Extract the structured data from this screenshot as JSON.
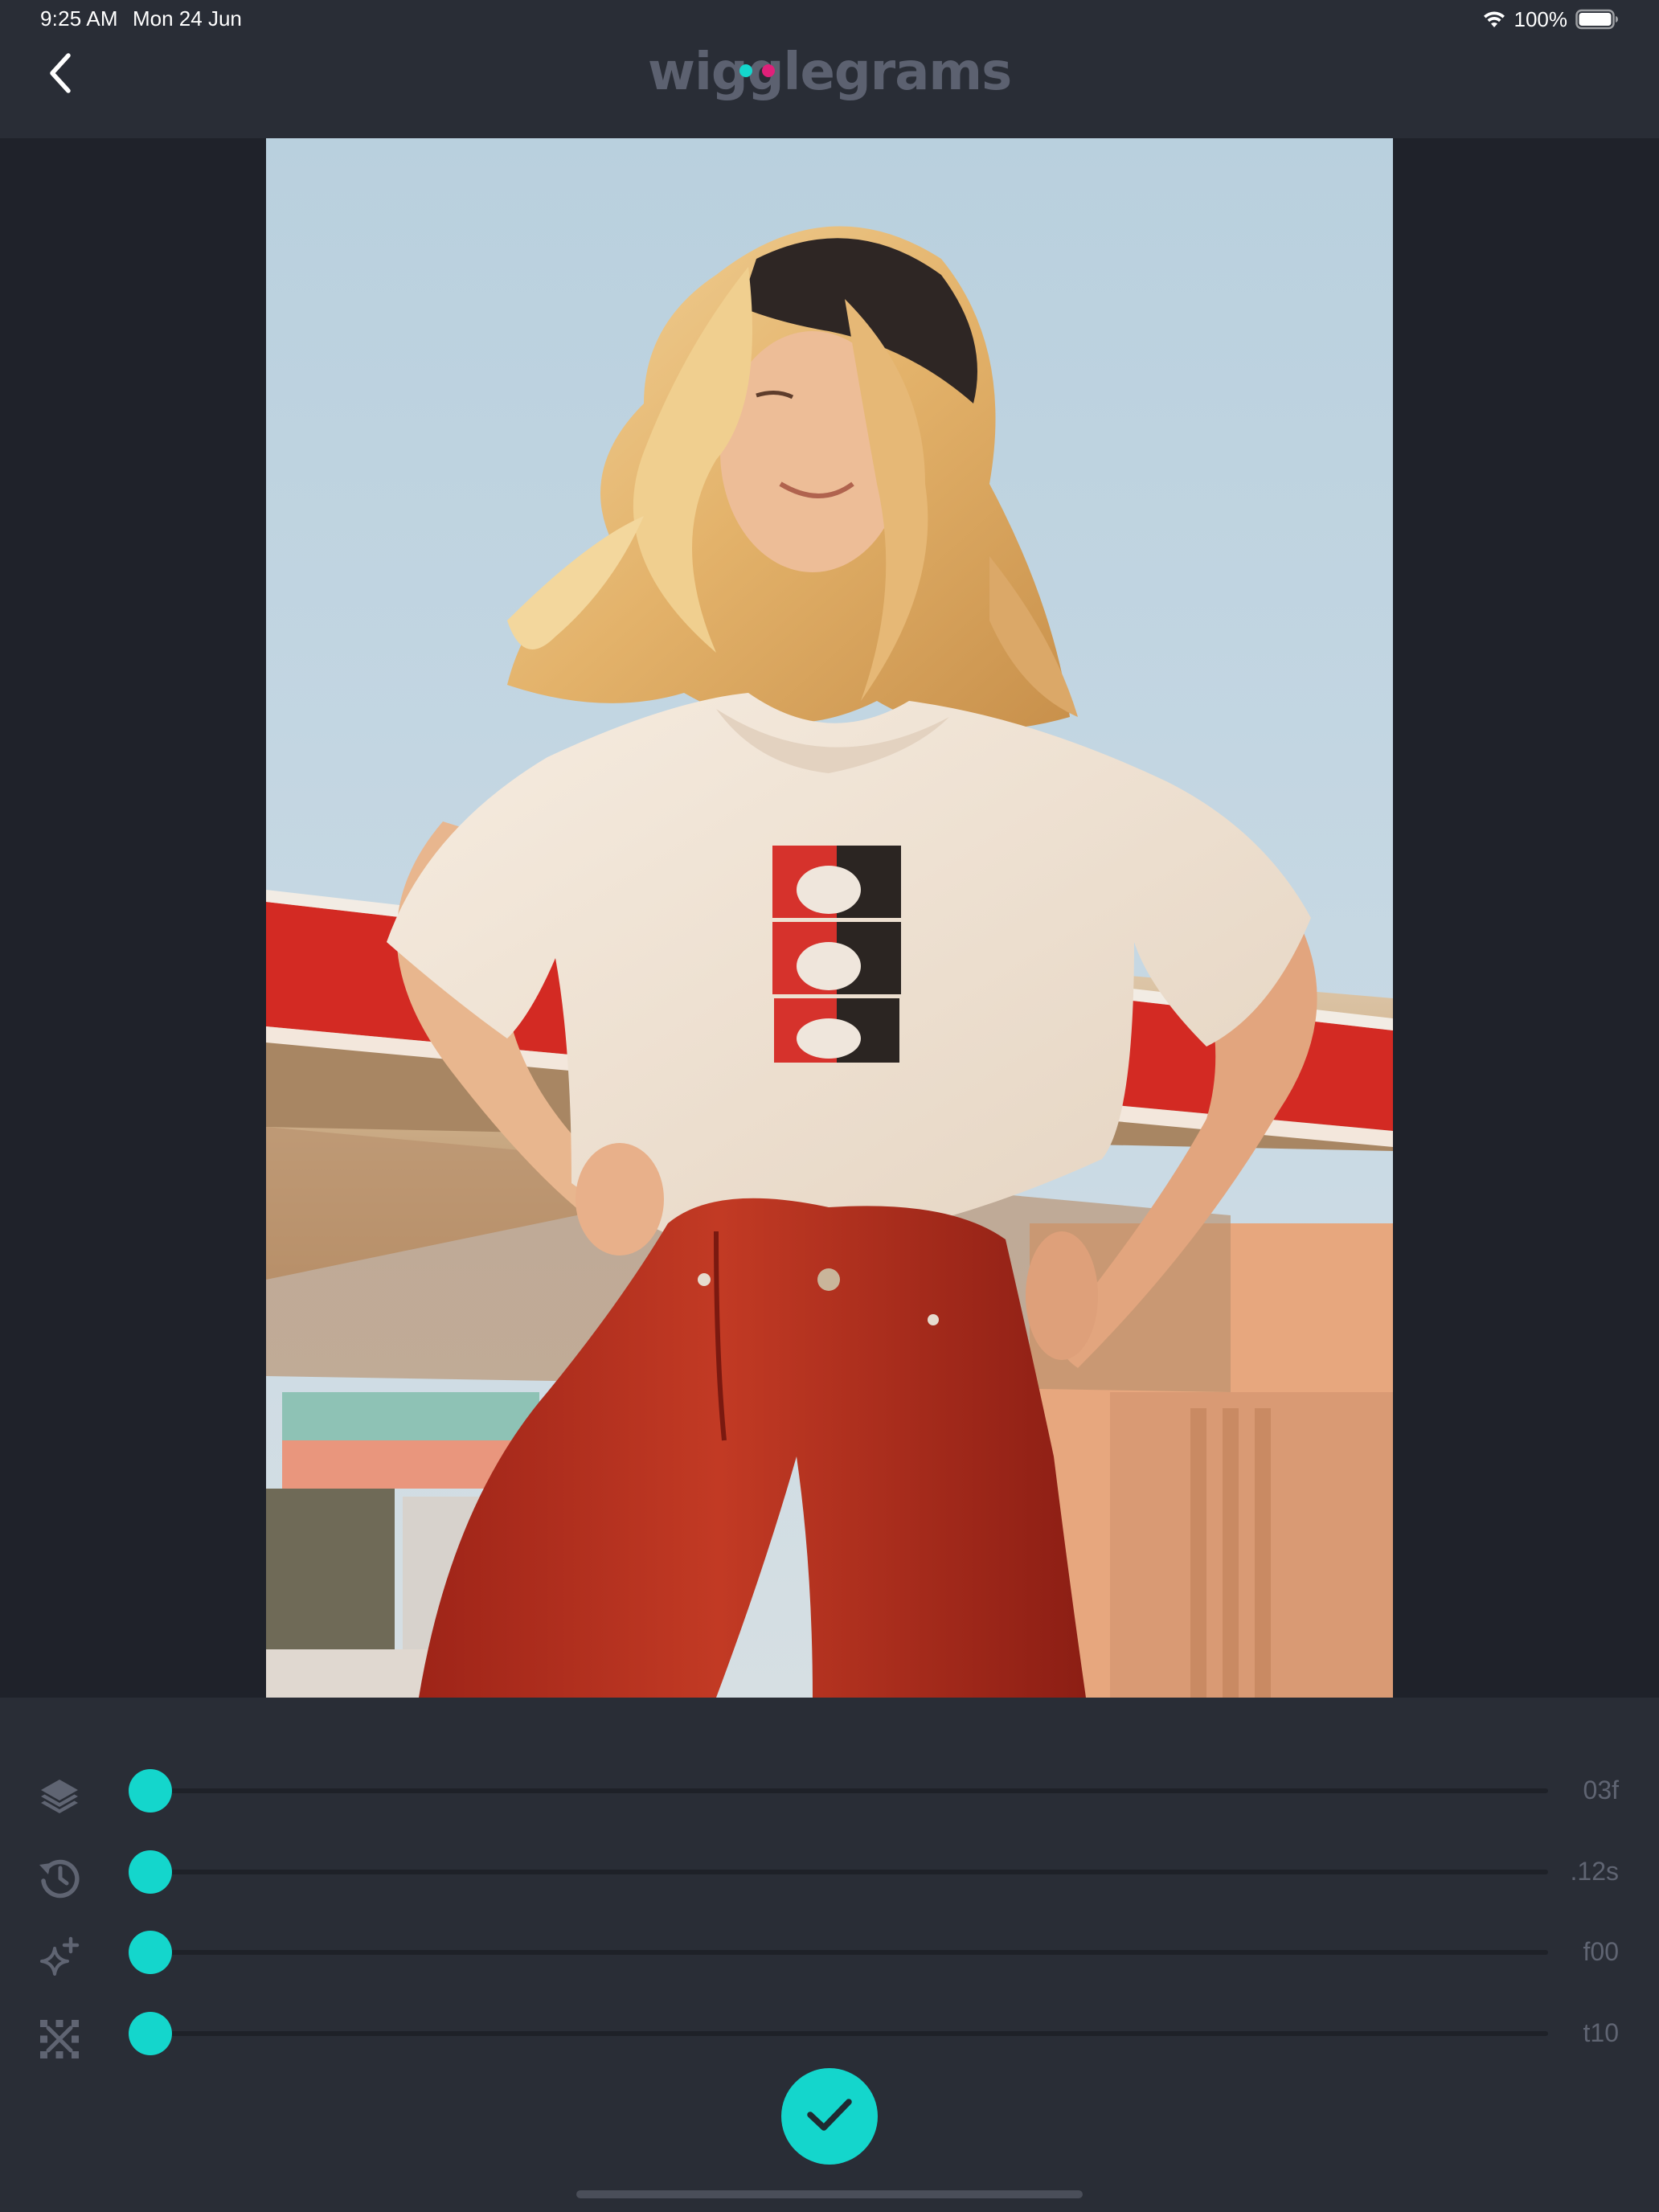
{
  "status_bar": {
    "time": "9:25 AM",
    "date": "Mon 24 Jun",
    "battery_percent": "100%",
    "wifi_icon": "wifi-icon",
    "battery_icon": "battery-full-icon"
  },
  "nav": {
    "back_icon": "chevron-left-icon",
    "app_title": "wigglegrams"
  },
  "brand": {
    "accent": "#14d6cc",
    "logo_dot_left": "#14d6cc",
    "logo_dot_right": "#e0207a"
  },
  "photo": {
    "description_icon": "photo-preview"
  },
  "sliders": [
    {
      "id": "frames",
      "icon": "layers-icon",
      "value_label": "03f",
      "level": 0
    },
    {
      "id": "speed",
      "icon": "history-icon",
      "value_label": ".12s",
      "level": 0
    },
    {
      "id": "effects",
      "icon": "sparkle-add-icon",
      "value_label": "f00",
      "level": 0
    },
    {
      "id": "tolerance",
      "icon": "align-grid-icon",
      "value_label": "t10",
      "level": 0
    }
  ],
  "confirm": {
    "icon": "checkmark-icon"
  }
}
